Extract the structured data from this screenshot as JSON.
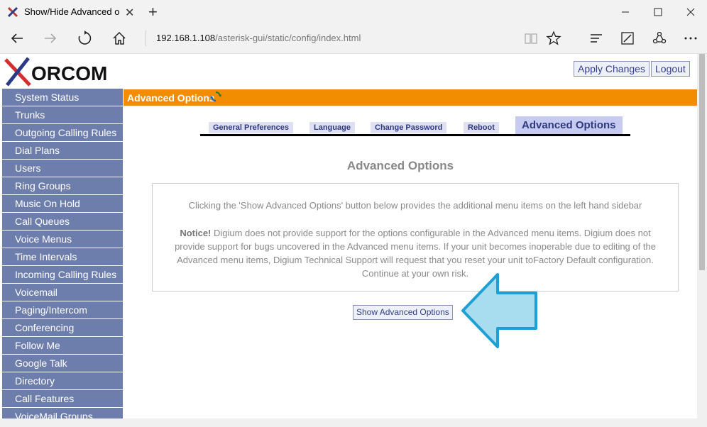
{
  "browser": {
    "tab_title": "Show/Hide Advanced o",
    "tab_close": "✕",
    "new_tab": "+",
    "url_host": "192.168.1.108",
    "url_path": "/asterisk-gui/static/config/index.html",
    "window_minimize": "—",
    "window_maximize": "☐",
    "window_close": "✕"
  },
  "header": {
    "logo_text": "ORCOM",
    "apply_changes": "Apply Changes",
    "logout": "Logout"
  },
  "sidebar": {
    "items": [
      "System Status",
      "Trunks",
      "Outgoing Calling Rules",
      "Dial Plans",
      "Users",
      "Ring Groups",
      "Music On Hold",
      "Call Queues",
      "Voice Menus",
      "Time Intervals",
      "Incoming Calling Rules",
      "Voicemail",
      "Paging/Intercom",
      "Conferencing",
      "Follow Me",
      "Google Talk",
      "Directory",
      "Call Features",
      "VoiceMail Groups"
    ]
  },
  "section": {
    "title": "Advanced Options"
  },
  "tabs": {
    "general": "General Preferences",
    "language": "Language",
    "password": "Change Password",
    "reboot": "Reboot",
    "advanced": "Advanced Options"
  },
  "main": {
    "title": "Advanced Options",
    "info_line": "Clicking the 'Show Advanced Options' button below provides the additional menu items on the left hand sidebar",
    "notice_label": "Notice!",
    "notice_text": " Digium does not provide support for the options configurable in the Advanced menu items. Digium does not provide support for bugs uncovered in the Advanced menu items. If your unit becomes inoperable due to editing of the Advanced menu items, Digium Technical Support will request that you reset your unit toFactory Default configuration. Continue at your own risk.",
    "show_button": "Show Advanced Options"
  },
  "colors": {
    "sidebar_bg": "#6e7eac",
    "header_bar": "#f28c00",
    "tab_active": "#c7cbef",
    "arrow_fill": "#a8dcef",
    "arrow_stroke": "#1e9fd6"
  }
}
